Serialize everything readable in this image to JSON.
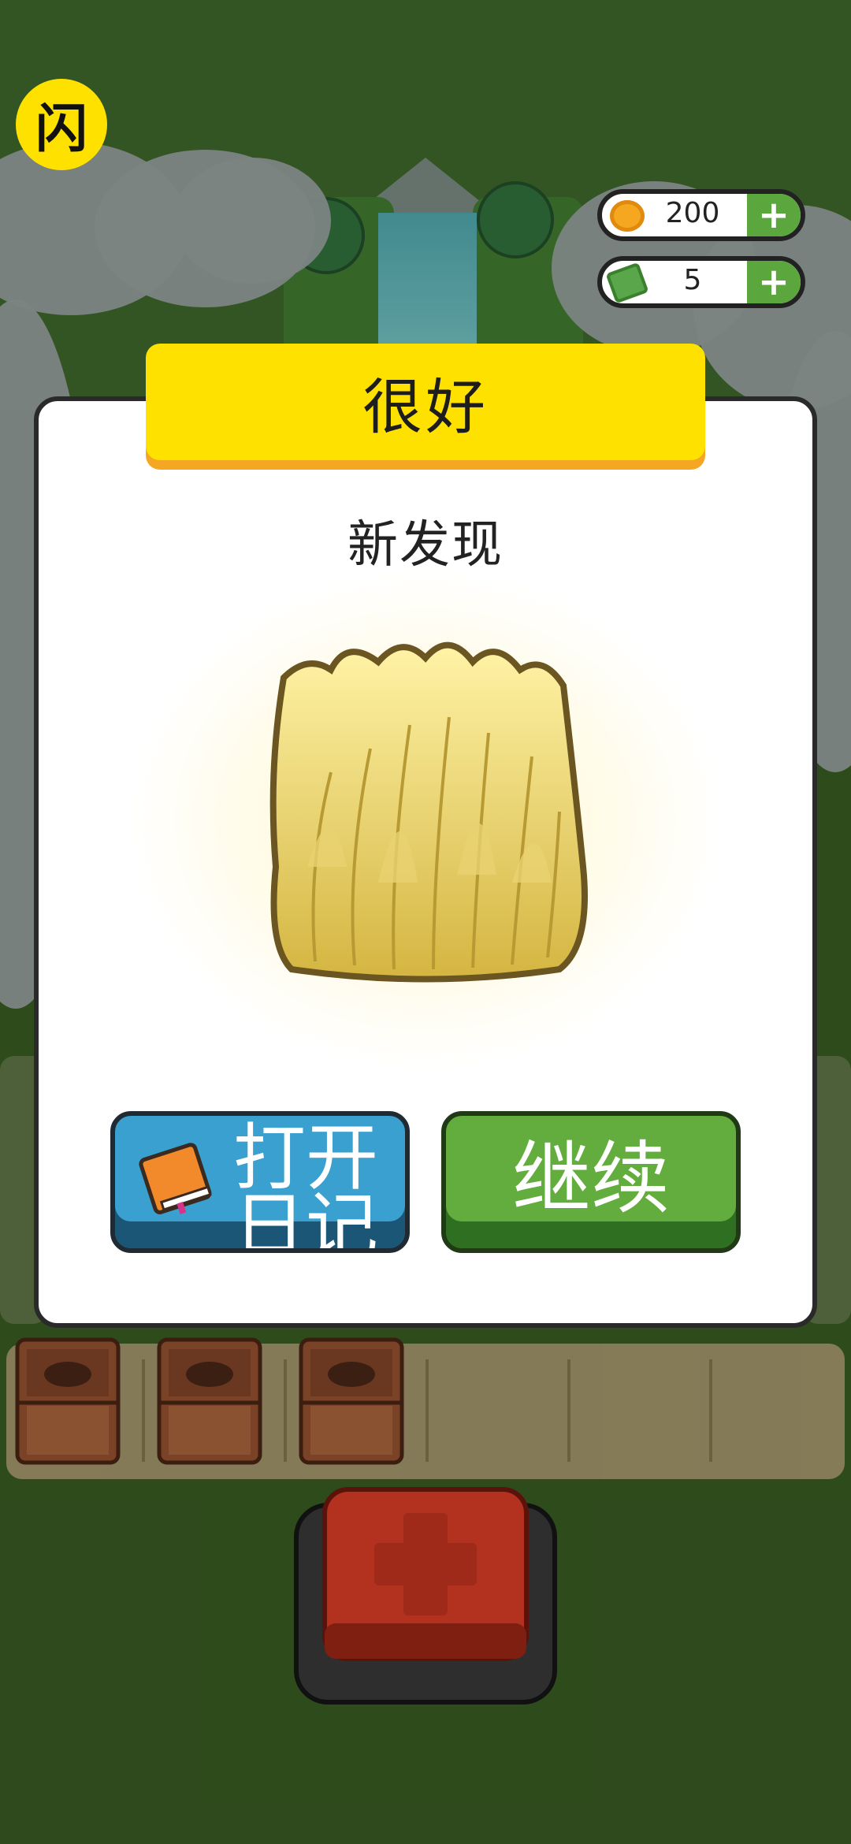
{
  "logo": {
    "glyph": "闪"
  },
  "currency": {
    "coins": {
      "icon": "coin-icon",
      "amount": "200",
      "plus": "+"
    },
    "cash": {
      "icon": "cash-icon",
      "amount": "5",
      "plus": "+"
    }
  },
  "dialog": {
    "title": "很好",
    "subtitle": "新发现",
    "item": {
      "icon": "hay-bush-icon"
    },
    "buttons": {
      "open_diary": {
        "label": "打开日记",
        "icon": "book-icon"
      },
      "continue": {
        "label": "继续"
      }
    }
  },
  "inventory": {
    "slots": [
      {
        "icon": "wooden-crate-icon"
      },
      {
        "icon": "wooden-crate-icon"
      },
      {
        "icon": "wooden-crate-icon"
      },
      {
        "icon": "empty"
      },
      {
        "icon": "empty"
      },
      {
        "icon": "empty"
      }
    ]
  },
  "add_button": {
    "icon": "plus-icon"
  },
  "colors": {
    "banner": "#ffe100",
    "continue_button": "#62ad3e",
    "diary_button": "#3aa0d0",
    "add_button": "#b3321f"
  }
}
